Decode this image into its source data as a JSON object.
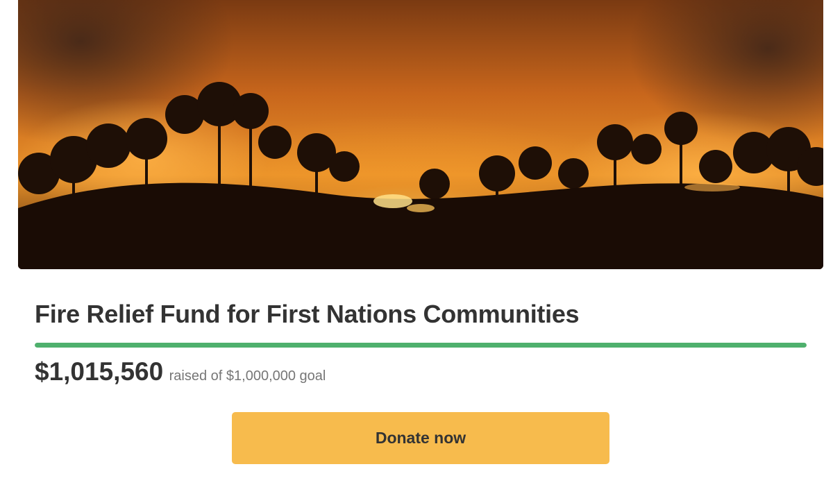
{
  "campaign": {
    "title": "Fire Relief Fund for First Nations Communities",
    "amount_raised": "$1,015,560",
    "goal_text": "raised of $1,000,000 goal",
    "progress_fraction": 1.0
  },
  "hero_image": {
    "icon": "bushfire-photo"
  },
  "actions": {
    "donate_label": "Donate now"
  },
  "colors": {
    "progress": "#4fb06d",
    "donate_button": "#f7bb4d",
    "title_text": "#333333",
    "muted_text": "#767676"
  }
}
